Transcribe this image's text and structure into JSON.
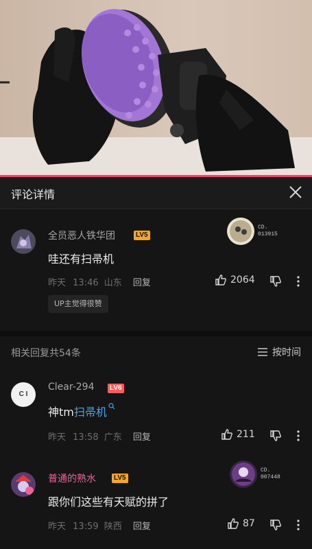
{
  "header": {
    "title": "评论详情"
  },
  "main_comment": {
    "username": "全员恶人铁华团",
    "level": "LV5",
    "text": "哇还有扫帚机",
    "date": "昨天",
    "time": "13:46",
    "location": "山东",
    "reply_label": "回复",
    "likes": "2064",
    "up_tag": "UP主觉得很赞",
    "fan_code_line1": "CD.",
    "fan_code_line2": "013915"
  },
  "related": {
    "label": "相关回复共54条",
    "sort_label": "按时间"
  },
  "replies": [
    {
      "username": "Clear-294",
      "level": "LV6",
      "avatar_text": "C I",
      "text_prefix": "神tm",
      "text_link": "扫帚机",
      "date": "昨天",
      "time": "13:58",
      "location": "广东",
      "reply_label": "回复",
      "likes": "211"
    },
    {
      "username": "普通的熟水",
      "level": "LV5",
      "text": "跟你们这些有天赋的拼了",
      "date": "昨天",
      "time": "13:59",
      "location": "陕西",
      "reply_label": "回复",
      "likes": "87",
      "fan_code_line1": "CD.",
      "fan_code_line2": "007448"
    }
  ],
  "colors": {
    "accent": "#ff3b6a",
    "lv5": "#f5a623",
    "lv6": "#ff5c5c",
    "link": "#4aa6e0",
    "pink_username": "#f0629a"
  }
}
